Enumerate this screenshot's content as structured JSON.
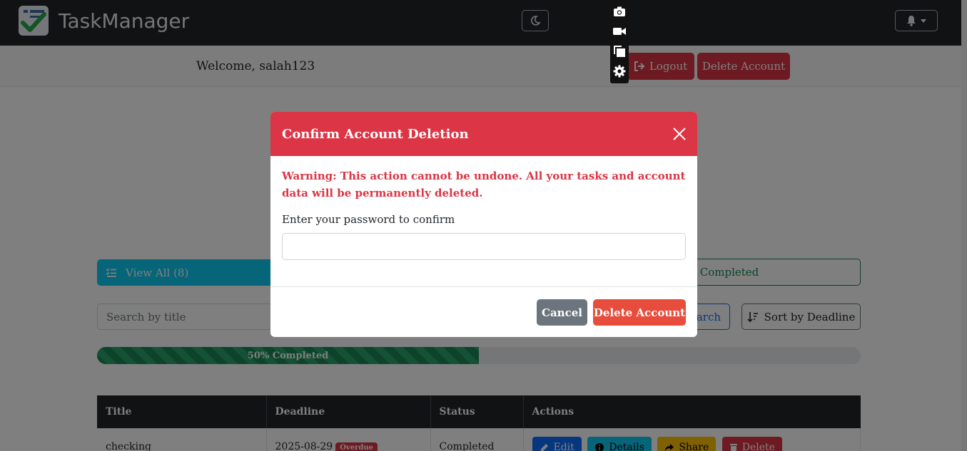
{
  "app": {
    "brand": "TaskManager"
  },
  "header": {
    "welcome": "Welcome, salah123",
    "logout": "Logout",
    "delete_account": "Delete Account"
  },
  "filters": {
    "view_all": "View All (8)",
    "completed": "Completed"
  },
  "search": {
    "placeholder": "Search by title",
    "button": "Search",
    "sort": "Sort by Deadline"
  },
  "progress": {
    "percent": 50,
    "label": "50% Completed"
  },
  "table": {
    "headers": [
      "Title",
      "Deadline",
      "Status",
      "Actions"
    ],
    "rows": [
      {
        "title": "checking",
        "deadline": "2025-08-29",
        "badge": "Overdue",
        "status": "Completed"
      }
    ],
    "actions": {
      "edit": "Edit",
      "details": "Details",
      "share": "Share",
      "delete": "Delete"
    }
  },
  "modal": {
    "title": "Confirm Account Deletion",
    "warning": "Warning: This action cannot be undone. All your tasks and account data will be permanently deleted.",
    "password_label": "Enter your password to confirm",
    "password_value": "",
    "cancel": "Cancel",
    "confirm": "Delete Account"
  },
  "colors": {
    "danger": "#dc3545",
    "navbar": "#212529",
    "info": "#0dcaf0",
    "success": "#198754"
  },
  "icons": [
    "checklist-logo-icon",
    "moon-icon",
    "bell-icon",
    "logout-icon",
    "list-icon",
    "sort-icon",
    "edit-icon",
    "info-icon",
    "share-icon",
    "trash-icon",
    "camera-icon",
    "video-icon",
    "copy-icon",
    "gear-icon",
    "close-icon"
  ]
}
